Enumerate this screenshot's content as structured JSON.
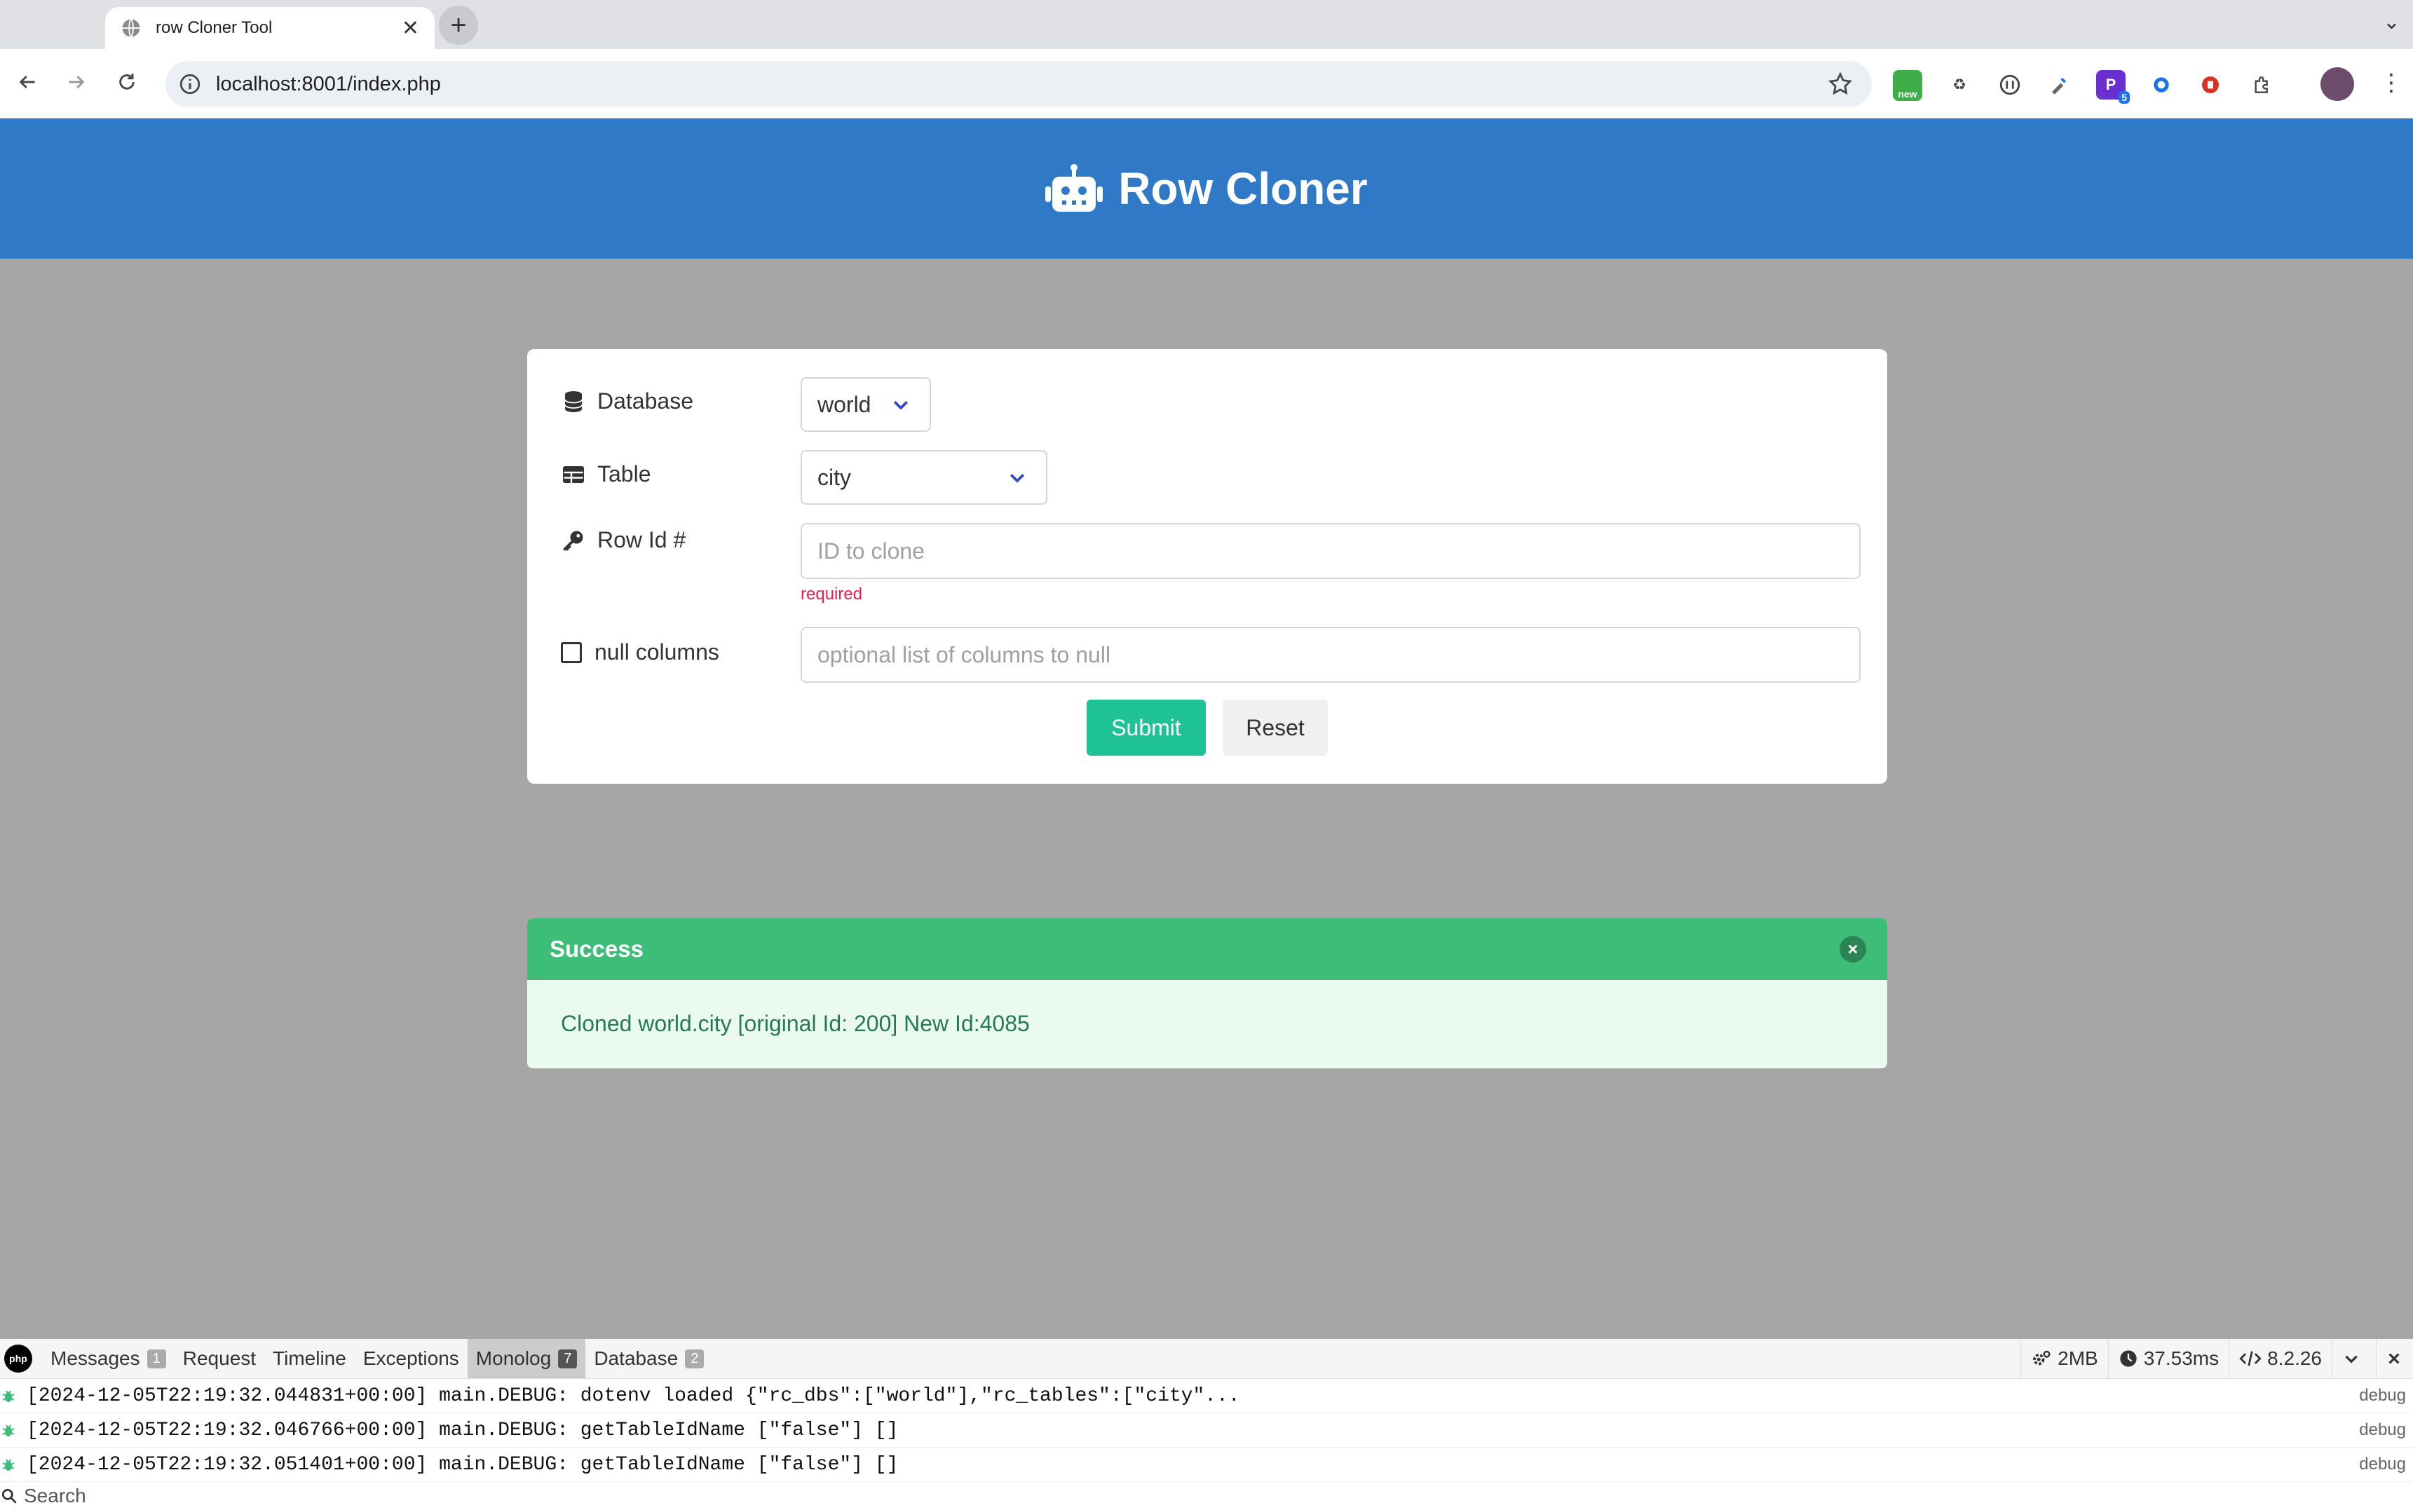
{
  "browser": {
    "tab_title": "row Cloner Tool",
    "url": "localhost:8001/index.php",
    "extensions": [
      {
        "name": "new-badge-extension-icon",
        "label": "new",
        "color": "#3fae49"
      },
      {
        "name": "recycle-extension-icon",
        "label": "",
        "color": "#444444"
      },
      {
        "name": "circle-extension-icon",
        "label": "",
        "color": "#444444"
      },
      {
        "name": "dropper-extension-icon",
        "label": "",
        "color": "#444444"
      },
      {
        "name": "p-extension-icon",
        "label": "P",
        "color": "#6a2fd1",
        "badge": "5"
      },
      {
        "name": "shield-extension-icon",
        "label": "",
        "color": "#1a73e8"
      },
      {
        "name": "red-extension-icon",
        "label": "",
        "color": "#d93025"
      },
      {
        "name": "puzzle-extension-icon",
        "label": "",
        "color": "#444444"
      }
    ]
  },
  "app": {
    "title": "Row Cloner",
    "brand_color": "#3079c7"
  },
  "form": {
    "database_label": "Database",
    "database_value": "world",
    "table_label": "Table",
    "table_value": "city",
    "rowid_label": "Row Id #",
    "rowid_placeholder": "ID to clone",
    "rowid_help": "required",
    "nullcols_label": "null columns",
    "nullcols_placeholder": "optional list of columns to null",
    "submit_label": "Submit",
    "reset_label": "Reset"
  },
  "notification": {
    "title": "Success",
    "message": "Cloned world.city [original Id: 200] New Id:4085",
    "color": "#3ebd79"
  },
  "debugbar": {
    "tabs": [
      {
        "label": "Messages",
        "badge": "1"
      },
      {
        "label": "Request",
        "badge": ""
      },
      {
        "label": "Timeline",
        "badge": ""
      },
      {
        "label": "Exceptions",
        "badge": ""
      },
      {
        "label": "Monolog",
        "badge": "7"
      },
      {
        "label": "Database",
        "badge": "2"
      }
    ],
    "memory": "2MB",
    "time": "37.53ms",
    "php_version": "8.2.26",
    "logs": [
      {
        "text": "[2024-12-05T22:19:32.044831+00:00] main.DEBUG: dotenv loaded {\"rc_dbs\":[\"world\"],\"rc_tables\":[\"city\"...",
        "level": "debug"
      },
      {
        "text": "[2024-12-05T22:19:32.046766+00:00] main.DEBUG: getTableIdName [\"false\"] []",
        "level": "debug"
      },
      {
        "text": "[2024-12-05T22:19:32.051401+00:00] main.DEBUG: getTableIdName [\"false\"] []",
        "level": "debug"
      }
    ],
    "search_placeholder": "Search"
  }
}
